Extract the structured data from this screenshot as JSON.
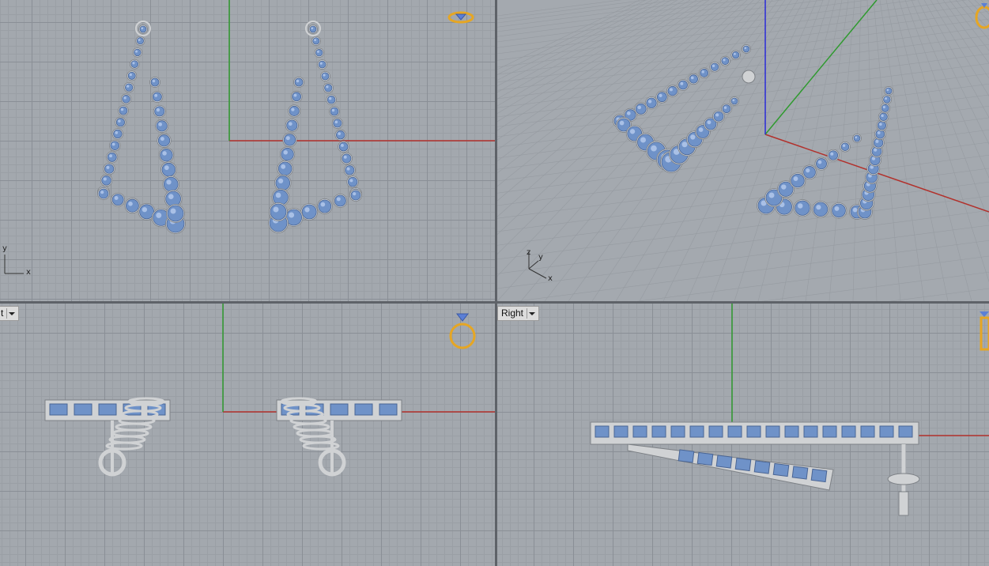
{
  "viewports": {
    "top": {
      "label": "",
      "axis_x": "x",
      "axis_y": "y"
    },
    "perspective": {
      "label": "",
      "axis_x": "x",
      "axis_y": "y",
      "axis_z": "z"
    },
    "front": {
      "label": "t"
    },
    "right": {
      "label": "Right"
    }
  },
  "colors": {
    "grid_bg": "#a3a8ae",
    "x_axis": "#b2312c",
    "y_axis": "#2f9a2f",
    "z_axis": "#2a2ad8",
    "gem": "#6f92c8",
    "metal": "#d0d2d4",
    "gizmo": "#e6a623"
  },
  "icons": [
    "ring-gem-gizmo-icon",
    "dropdown-arrow-icon"
  ]
}
